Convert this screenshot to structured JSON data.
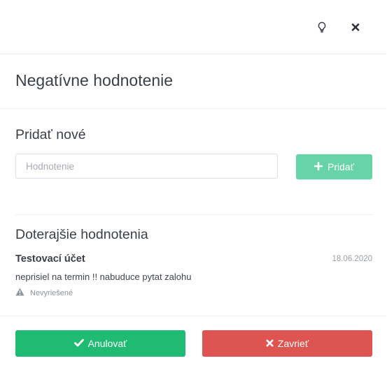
{
  "header": {
    "tip_icon": "lightbulb-icon",
    "close_icon": "close-icon"
  },
  "title": "Negatívne hodnotenie",
  "add_section": {
    "title": "Pridať nové",
    "input_placeholder": "Hodnotenie",
    "input_value": "",
    "add_label": "Pridať",
    "add_icon": "plus-icon"
  },
  "list_section": {
    "title": "Doterajšie hodnotenia",
    "items": [
      {
        "name": "Testovací účet",
        "date": "18.06.2020",
        "text": "neprisiel na termin !! nabuduce pytat zalohu",
        "status": "Nevyriešené",
        "status_icon": "warning-icon"
      }
    ]
  },
  "footer": {
    "confirm_label": "Anulovať",
    "confirm_icon": "check-icon",
    "close_label": "Zavrieť",
    "close_icon": "close-icon"
  },
  "colors": {
    "confirm": "#1fbb72",
    "close": "#dd5451",
    "add": "#66d4a6"
  }
}
